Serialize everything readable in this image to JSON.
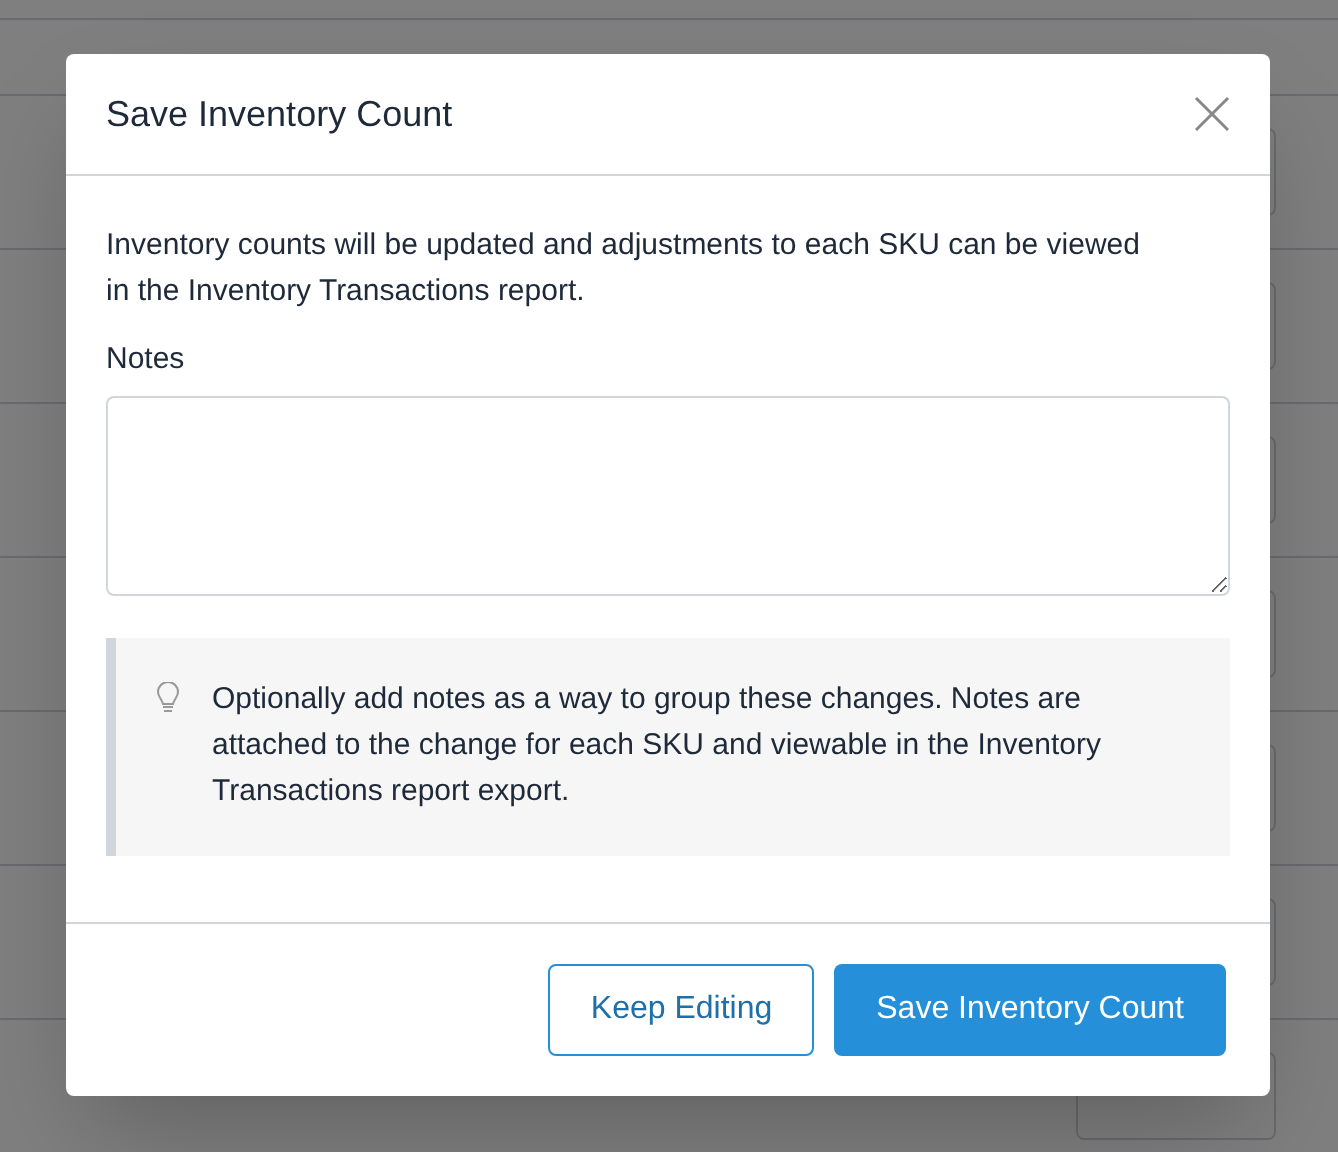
{
  "dialog": {
    "title": "Save Inventory Count",
    "message": "Inventory counts will be updated and adjustments to each SKU can be viewed in the Inventory Transactions report.",
    "notes_label": "Notes",
    "tip": "Optionally add notes as a way to group these changes. Notes are attached to the change for each SKU and viewable in the Inventory Transactions report export.",
    "buttons": [
      {
        "label": "Keep Editing",
        "kind": "secondary"
      },
      {
        "label": "Save Inventory Count",
        "kind": "primary"
      }
    ]
  }
}
